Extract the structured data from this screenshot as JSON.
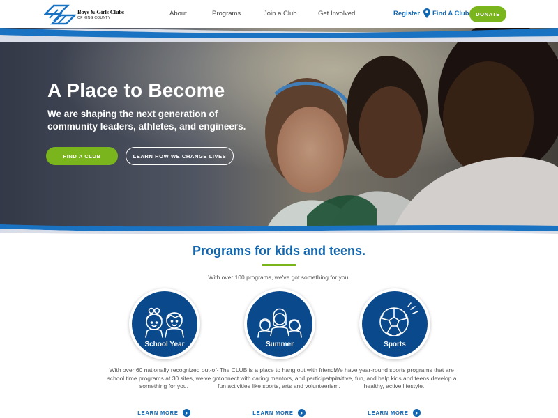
{
  "header": {
    "logo_line1": "Boys & Girls Clubs",
    "logo_line2": "OF KING COUNTY",
    "nav": [
      {
        "label": "About"
      },
      {
        "label": "Programs"
      },
      {
        "label": "Join a Club"
      },
      {
        "label": "Get Involved"
      }
    ],
    "register_label": "Register",
    "find_club_label": "Find A Club",
    "donate_label": "DONATE"
  },
  "hero": {
    "title": "A Place to Become",
    "subtitle": "We are shaping the next generation of community leaders, athletes, and engineers.",
    "find_club_button": "FIND A CLUB",
    "learn_button": "LEARN HOW WE CHANGE LIVES"
  },
  "programs": {
    "title": "Programs for kids and teens.",
    "subtitle": "With over 100 programs, we've got something for you.",
    "cards": [
      {
        "label": "School Year",
        "icon": "kids-icon",
        "description": "With over 60 nationally recognized out-of-school time programs at 30 sites, we've got something for you.",
        "link": "LEARN MORE"
      },
      {
        "label": "Summer",
        "icon": "group-icon",
        "description": "The CLUB is a place to hang out with friends, connect with caring mentors, and participate in fun activities like sports, arts and volunteerism.",
        "link": "LEARN MORE"
      },
      {
        "label": "Sports",
        "icon": "soccer-ball-icon",
        "description": "We have year-round sports programs that are positive, fun, and help kids and teens develop a healthy, active lifestyle.",
        "link": "LEARN MORE"
      }
    ]
  },
  "colors": {
    "brand_blue": "#1066b0",
    "navy": "#0a4a8c",
    "green": "#7ab51d"
  }
}
